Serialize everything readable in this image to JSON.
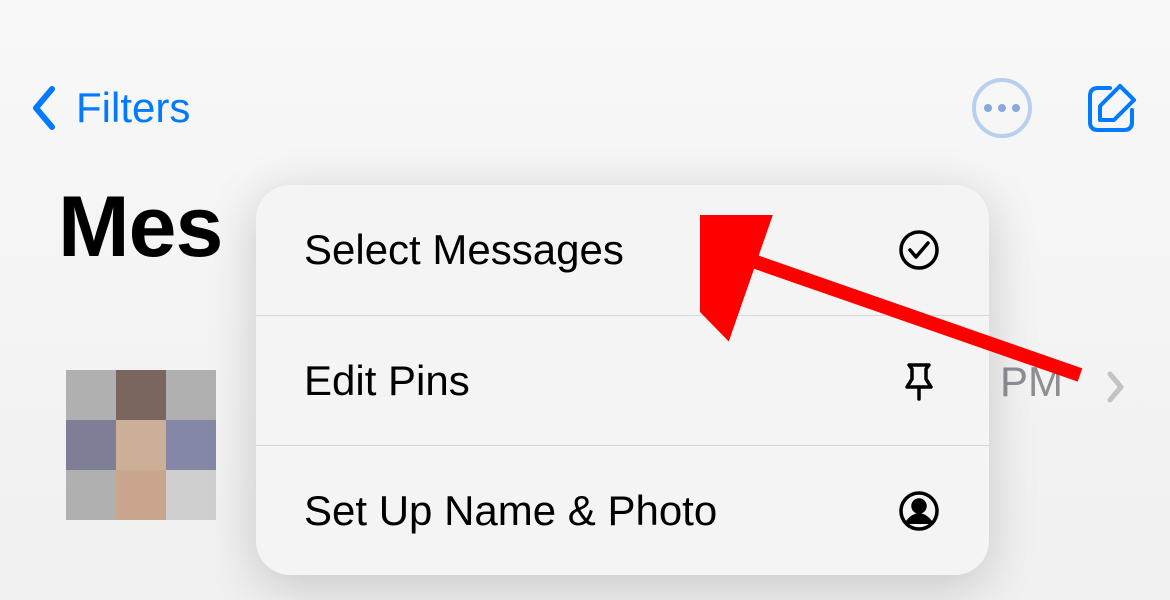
{
  "nav": {
    "back_label": "Filters"
  },
  "page": {
    "title_visible": "Mes"
  },
  "menu": {
    "items": [
      {
        "label": "Select Messages",
        "icon": "checkmark-circle-icon"
      },
      {
        "label": "Edit Pins",
        "icon": "pin-icon"
      },
      {
        "label": "Set Up Name & Photo",
        "icon": "person-circle-icon"
      }
    ]
  },
  "list": {
    "time_partial": "PM"
  },
  "colors": {
    "accent": "#007AFF",
    "annotation": "#FF0000"
  },
  "avatar_pixels": [
    "#b0b0b0",
    "#7a665e",
    "#b0b0b0",
    "#7e7e96",
    "#cbaf99",
    "#8587a6",
    "#b0b0b0",
    "#caa58d",
    "#cfcfcf"
  ]
}
